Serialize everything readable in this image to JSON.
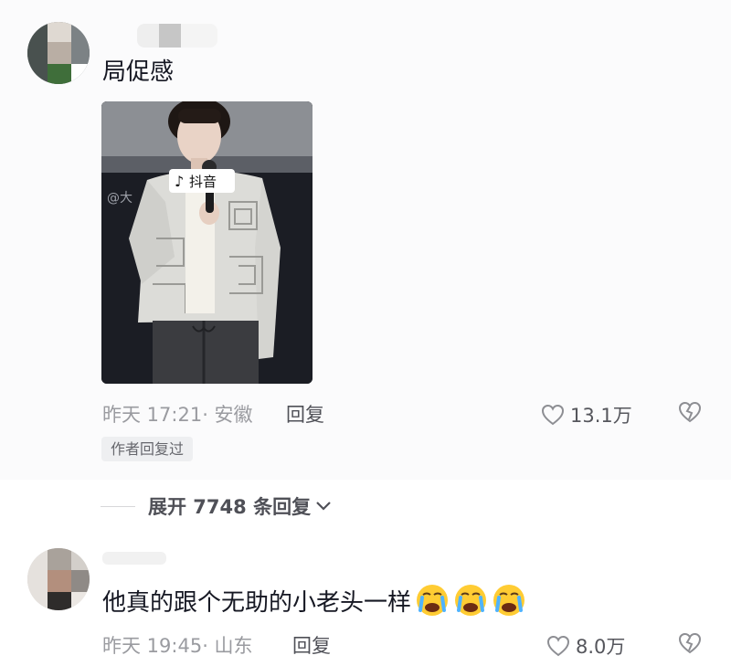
{
  "comments": [
    {
      "text": "局促感",
      "time_location": "昨天 17:21· 安徽",
      "reply_label": "回复",
      "like_count": "13.1万",
      "author_badge": "作者回复过",
      "photo_watermark_handle": "@大",
      "photo_logo_text": "抖音",
      "expand_label": "展开 7748 条回复"
    },
    {
      "text": "他真的跟个无助的小老头一样",
      "emoji": [
        "crying-face",
        "crying-face",
        "crying-face"
      ],
      "time_location": "昨天 19:45· 山东",
      "reply_label": "回复",
      "like_count": "8.0万"
    }
  ],
  "colors": {
    "background": "#ffffff",
    "highlight_background": "#fbfbfc",
    "primary_text": "#161823",
    "secondary_text": "#9a9ba0",
    "badge_background": "#eeeff1"
  }
}
